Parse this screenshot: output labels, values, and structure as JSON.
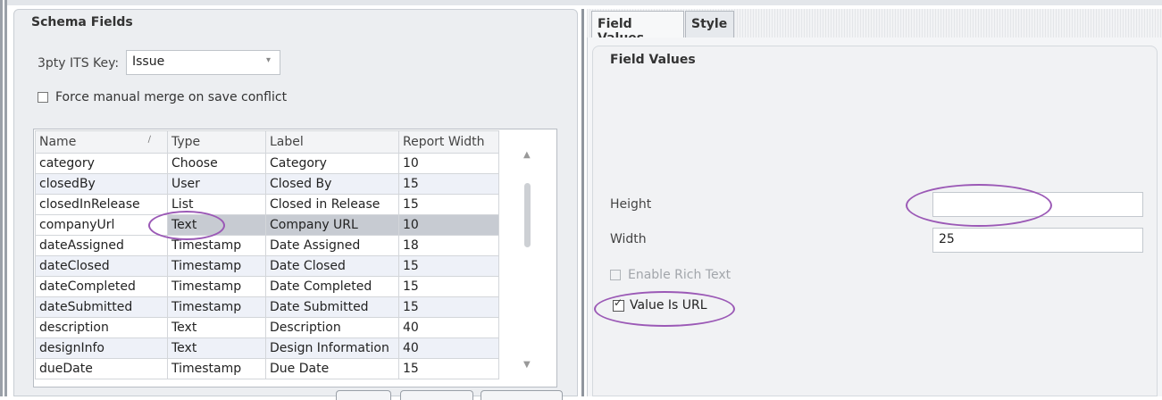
{
  "schema_fields": {
    "title": "Schema Fields",
    "its_key_label": "3pty ITS Key:",
    "its_key_value": "Issue",
    "force_merge_label": "Force manual merge on save conflict",
    "force_merge_checked": false,
    "columns": [
      "Name",
      "Type",
      "Label",
      "Report Width"
    ],
    "rows": [
      {
        "name": "category",
        "type": "Choose",
        "label": "Category",
        "width": "10"
      },
      {
        "name": "closedBy",
        "type": "User",
        "label": "Closed By",
        "width": "15"
      },
      {
        "name": "closedInRelease",
        "type": "List",
        "label": "Closed in Release",
        "width": "15"
      },
      {
        "name": "companyUrl",
        "type": "Text",
        "label": "Company URL",
        "width": "10"
      },
      {
        "name": "dateAssigned",
        "type": "Timestamp",
        "label": "Date Assigned",
        "width": "18"
      },
      {
        "name": "dateClosed",
        "type": "Timestamp",
        "label": "Date Closed",
        "width": "15"
      },
      {
        "name": "dateCompleted",
        "type": "Timestamp",
        "label": "Date Completed",
        "width": "15"
      },
      {
        "name": "dateSubmitted",
        "type": "Timestamp",
        "label": "Date Submitted",
        "width": "15"
      },
      {
        "name": "description",
        "type": "Text",
        "label": "Description",
        "width": "40"
      },
      {
        "name": "designInfo",
        "type": "Text",
        "label": "Design Information",
        "width": "40"
      },
      {
        "name": "dueDate",
        "type": "Timestamp",
        "label": "Due Date",
        "width": "15"
      }
    ],
    "selected_row": "companyUrl"
  },
  "tabs": [
    "Field Values",
    "Style"
  ],
  "field_values": {
    "title": "Field Values",
    "height_label": "Height",
    "height_value": "",
    "width_label": "Width",
    "width_value": "25",
    "rich_text_label": "Enable Rich Text",
    "rich_text_checked": false,
    "value_is_url_label": "Value Is URL",
    "value_is_url_checked": true
  },
  "icons": {
    "sort": "sort-indicator-icon",
    "dropdown": "chevron-down-icon",
    "scroll_up": "scroll-up-icon",
    "scroll_down": "scroll-down-icon"
  },
  "colors": {
    "highlight_circle": "#9b59b6",
    "selected_row": "#c7cbd2",
    "alt_row": "#eef1f8"
  }
}
